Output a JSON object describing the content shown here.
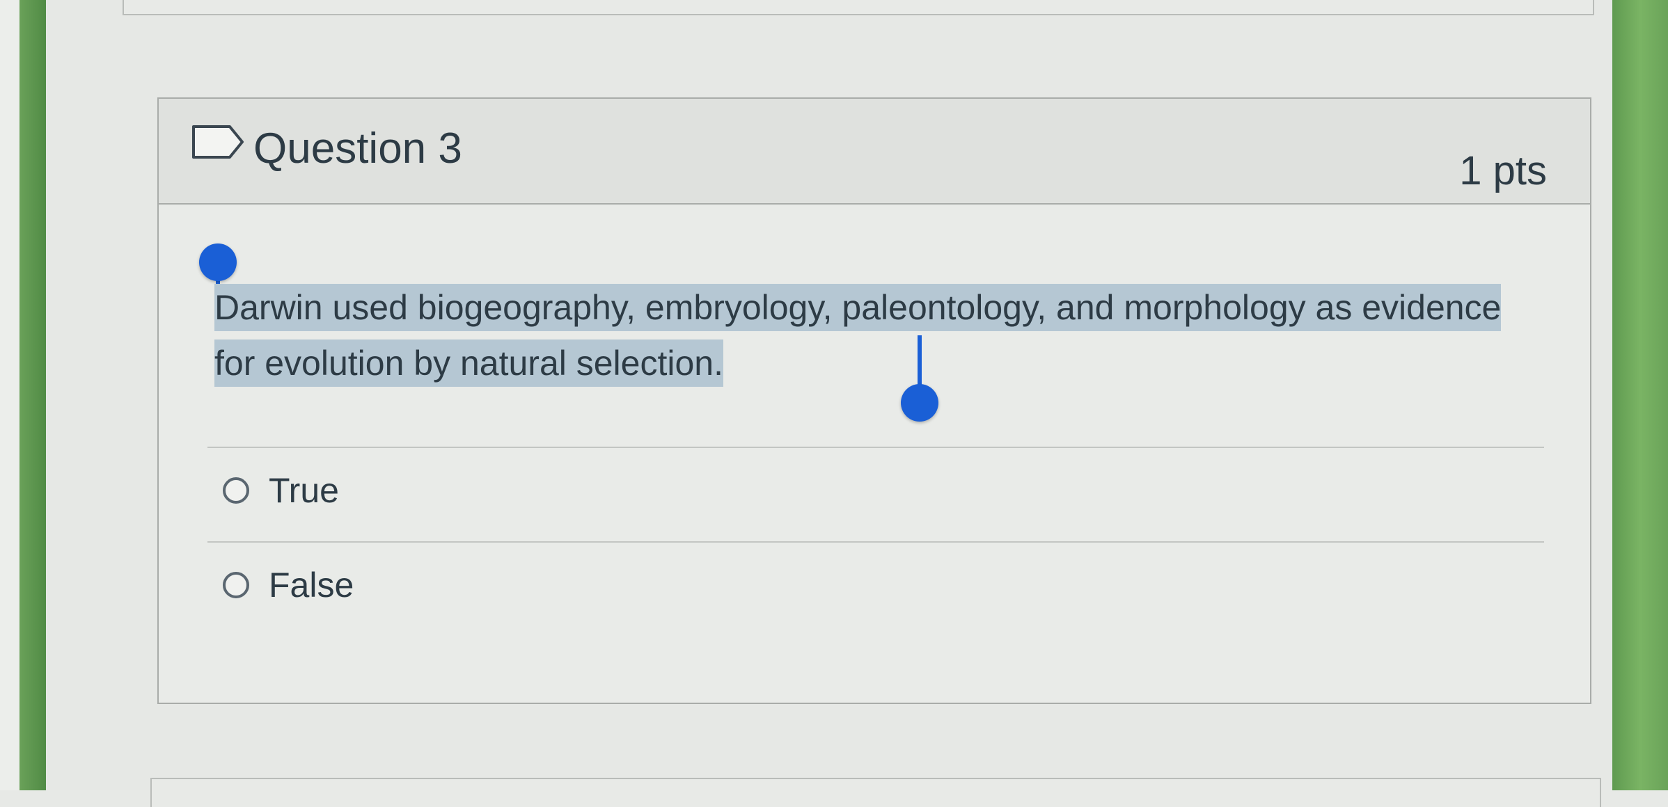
{
  "question": {
    "title": "Question 3",
    "points": "1 pts",
    "flag_icon": "flag-question-icon",
    "text": "Darwin used biogeography, embryology, paleontology, and morphology as evidence for evolution by natural selection.",
    "selection_color": "#b5c7d3",
    "handle_color": "#1a5fd6"
  },
  "answers": [
    {
      "label": "True",
      "selected": false
    },
    {
      "label": "False",
      "selected": false
    }
  ]
}
